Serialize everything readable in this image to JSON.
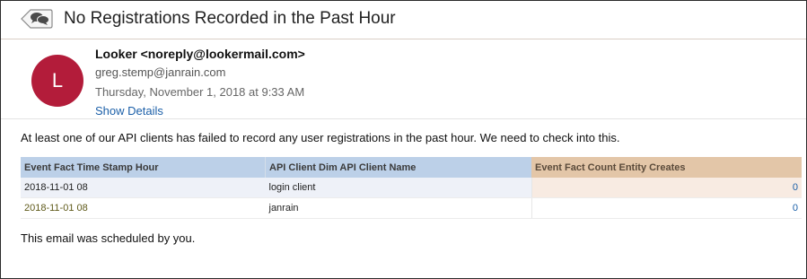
{
  "email": {
    "subject": "No Registrations Recorded in the Past Hour",
    "avatar_initial": "L",
    "sender": "Looker <noreply@lookermail.com>",
    "to": "greg.stemp@janrain.com",
    "date": "Thursday, November 1, 2018 at 9:33 AM",
    "show_details_label": "Show Details",
    "body_text": "At least one of our API clients has failed to record any user registrations in the past hour. We need to check into this.",
    "footer_text": "This email was scheduled by you.",
    "icons": {
      "conversation": "conversation-back-icon"
    },
    "colors": {
      "avatar": "#b31c3a",
      "link": "#1b5fa8",
      "dimension_header": "#bcd0e8",
      "measure_header": "#e3c6a8"
    }
  },
  "table": {
    "headers": [
      "Event Fact Time Stamp Hour",
      "API Client Dim API Client Name",
      "Event Fact Count Entity Creates"
    ],
    "rows": [
      [
        "2018-11-01 08",
        "login client",
        "0"
      ],
      [
        "2018-11-01 08",
        "janrain",
        "0"
      ]
    ]
  }
}
